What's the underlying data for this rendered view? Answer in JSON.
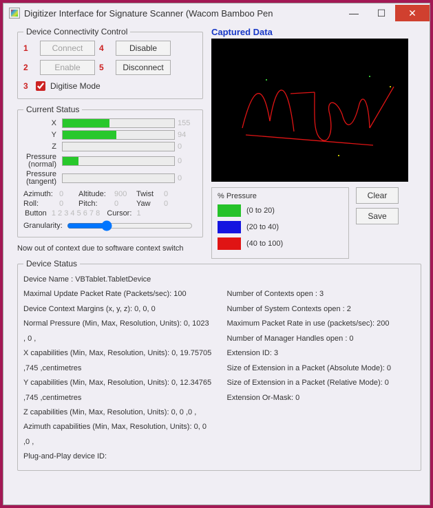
{
  "window": {
    "title": "Digitizer Interface for Signature Scanner (Wacom Bamboo Pen",
    "min": "—",
    "max": "☐",
    "close": "✕"
  },
  "conn": {
    "legend": "Device Connectivity Control",
    "n1": "1",
    "connect": "Connect",
    "n4": "4",
    "disable": "Disable",
    "n2": "2",
    "enable": "Enable",
    "n5": "5",
    "disconnect": "Disconnect",
    "n3": "3",
    "digitise": "Digitise Mode"
  },
  "status": {
    "legend": "Current Status",
    "bars": {
      "x": {
        "label": "X",
        "value": 155,
        "pct": 42
      },
      "y": {
        "label": "Y",
        "value": 94,
        "pct": 48
      },
      "z": {
        "label": "Z",
        "value": 0,
        "pct": 0
      },
      "pn": {
        "label": "Pressure (normal)",
        "value": 0,
        "pct": 14
      },
      "pt": {
        "label": "Pressure (tangent)",
        "value": 0,
        "pct": 0
      }
    },
    "kv": {
      "azimuth_l": "Azimuth:",
      "azimuth_v": "0",
      "altitude_l": "Altitude:",
      "altitude_v": "900",
      "twist_l": "Twist",
      "twist_v": "0",
      "roll_l": "Roll:",
      "roll_v": "0",
      "pitch_l": "Pitch:",
      "pitch_v": "0",
      "yaw_l": "Yaw",
      "yaw_v": "0"
    },
    "button_l": "Button",
    "buttons": "1  2  3  4  5  6  7  8",
    "cursor_l": "Cursor:",
    "cursor_v": "1",
    "gran_l": "Granularity:",
    "message": "Now out of context due to software context switch"
  },
  "captured": {
    "title": "Captured Data"
  },
  "pct": {
    "legend": "% Pressure",
    "g": "(0 to 20)",
    "b": "(20 to 40)",
    "r": "(40 to 100)"
  },
  "buttons": {
    "clear": "Clear",
    "save": "Save"
  },
  "dev": {
    "legend": "Device Status",
    "l1": "Device Name : VBTablet.TabletDevice",
    "l2": "Maximal Update Packet Rate (Packets/sec): 100",
    "l3": "Device Context Margins (x, y, z): 0, 0, 0",
    "l4": "Normal Pressure (Min, Max, Resolution, Units): 0, 1023 , 0 ,",
    "l5": "X capabilities (Min, Max, Resolution, Units): 0, 19.75705 ,745 ,centimetres",
    "l6": "Y capabilities (Min, Max, Resolution, Units): 0, 12.34765 ,745 ,centimetres",
    "l7": "Z capabilities (Min, Max, Resolution, Units): 0, 0 ,0 ,",
    "l8": "Azimuth capabilities (Min, Max, Resolution, Units): 0, 0 ,0 ,",
    "l9": "Plug-and-Play device ID:",
    "r1": "Number of Contexts open : 3",
    "r2": "Number of System Contexts open : 2",
    "r3": "Maximum Packet Rate in use (packets/sec): 200",
    "r4": "Number of Manager Handles open : 0",
    "r5": "Extension ID: 3",
    "r6": "Size of Extension in a Packet (Absolute Mode): 0",
    "r7": "Size of Extension in a Packet (Relative Mode): 0",
    "r8": "Extension Or-Mask: 0"
  }
}
